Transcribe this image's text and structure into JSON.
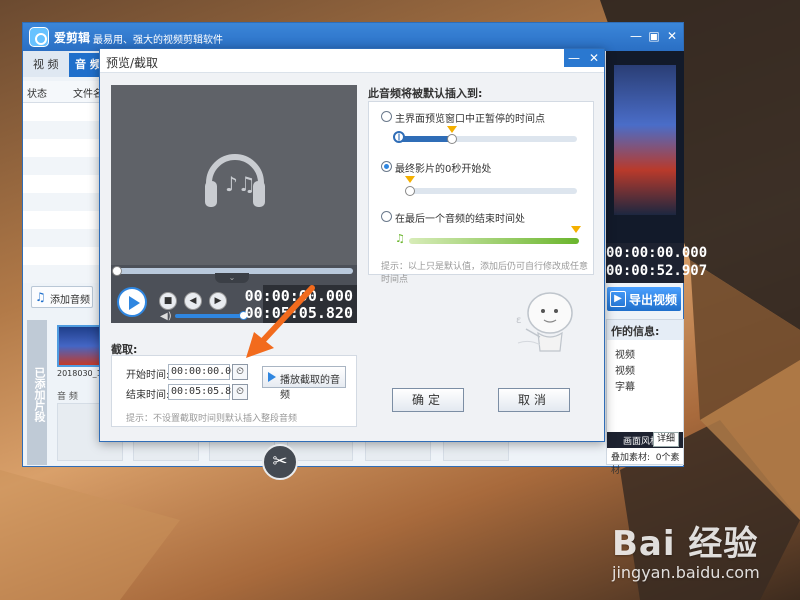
{
  "app": {
    "name": "爱剪辑",
    "slogan": "最易用、强大的视频剪辑软件"
  },
  "main_tabs": [
    {
      "label": "视  频"
    },
    {
      "label": "音  频"
    }
  ],
  "list_columns": [
    "状态",
    "文件名"
  ],
  "add_audio_label": "添加音频",
  "side_label": "已添加片段",
  "clip_thumb_caption": "2018030_1",
  "audio_track_label": "音  频",
  "preview_time": {
    "current": "00:00:00.000",
    "total": "00:00:52.907"
  },
  "export_label": "导出视频",
  "info_panel": {
    "heading": "作的信息:",
    "items": [
      "视频",
      "视频",
      "字幕"
    ],
    "row_text": "画面风格",
    "detail_label": "详细",
    "extra_label": "叠加素材:",
    "extra_value": "0个素材"
  },
  "dialog": {
    "title": "预览/截取",
    "player": {
      "current_time": "00:00:00.000",
      "total_time": "00:05:05.820"
    },
    "cut": {
      "title": "截取:",
      "start_label": "开始时间:",
      "start_value": "00:00:00.000",
      "end_label": "结束时间:",
      "end_value": "00:05:05.820",
      "play_cut_label": "播放截取的音频",
      "tip": "提示：不设置截取时间则默认插入整段音频"
    },
    "insert": {
      "title": "此音频将被默认插入到:",
      "options": [
        {
          "label": "主界面预览窗口中正暂停的时间点",
          "selected": false
        },
        {
          "label": "最终影片的0秒开始处",
          "selected": true
        },
        {
          "label": "在最后一个音频的结束时间处",
          "selected": false
        }
      ],
      "tip": "提示：以上只是默认值，添加后仍可自行修改成任意时间点"
    },
    "ok_label": "确定",
    "cancel_label": "取消"
  },
  "watermark": {
    "logo": "Bai 经验",
    "url": "jingyan.baidu.com"
  },
  "colors": {
    "accent_blue": "#2f86e0",
    "title_blue": "#2a6fc4",
    "marker_yellow": "#f5b000",
    "arrow_orange": "#f26b1d"
  }
}
